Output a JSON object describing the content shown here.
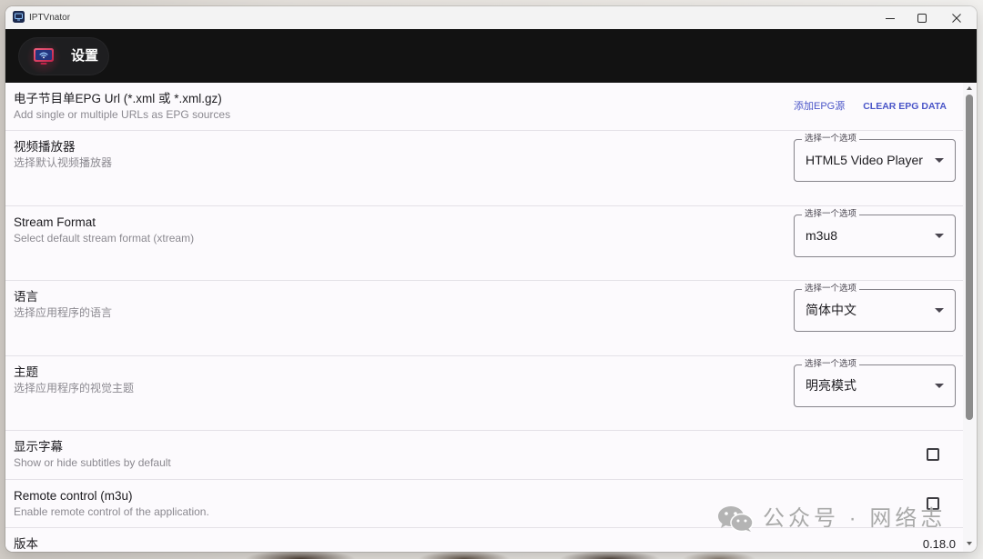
{
  "window": {
    "title": "IPTVnator",
    "icon": "iptvnator-app-icon",
    "controls": [
      "minimize-icon",
      "maximize-icon",
      "close-icon"
    ]
  },
  "header": {
    "settings_label": "设置",
    "settings_icon": "tv-icon"
  },
  "settings": {
    "epg": {
      "title": "电子节目单EPG Url (*.xml 或 *.xml.gz)",
      "subtitle": "Add single or multiple URLs as EPG sources",
      "add_button": "添加EPG源",
      "clear_button": "CLEAR EPG DATA"
    },
    "video_player": {
      "title": "视频播放器",
      "subtitle": "选择默认视频播放器",
      "select_label": "选择一个选项",
      "selected": "HTML5 Video Player"
    },
    "stream_format": {
      "title": "Stream Format",
      "subtitle": "Select default stream format (xtream)",
      "select_label": "选择一个选项",
      "selected": "m3u8"
    },
    "language": {
      "title": "语言",
      "subtitle": "选择应用程序的语言",
      "select_label": "选择一个选项",
      "selected": "简体中文"
    },
    "theme": {
      "title": "主题",
      "subtitle": "选择应用程序的视觉主题",
      "select_label": "选择一个选项",
      "selected": "明亮模式"
    },
    "subtitles": {
      "title": "显示字幕",
      "subtitle": "Show or hide subtitles by default",
      "checked": false
    },
    "remote_control": {
      "title": "Remote control (m3u)",
      "subtitle": "Enable remote control of the application.",
      "checked": false
    },
    "version": {
      "title": "版本",
      "value": "0.18.0"
    }
  },
  "colors": {
    "accent": "#4a55c8",
    "header_bg": "#121212",
    "surface": "#fcfafd"
  },
  "watermark": {
    "icon": "wechat-icon",
    "text": "公众号 · 网络志"
  }
}
